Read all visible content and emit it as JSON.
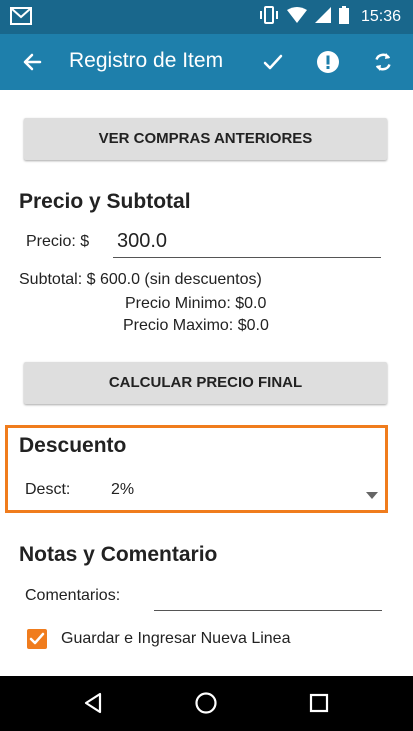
{
  "status_bar": {
    "time": "15:36"
  },
  "app_bar": {
    "title": "Registro de Item",
    "back_icon": "back-arrow-icon",
    "actions": [
      "check-icon",
      "alert-icon",
      "refresh-icon"
    ]
  },
  "buttons": {
    "ver_compras": "VER COMPRAS ANTERIORES",
    "calcular": "CALCULAR PRECIO FINAL"
  },
  "precio_section": {
    "title": "Precio y Subtotal",
    "precio_label": "Precio: $",
    "precio_value": "300.0",
    "subtotal": "Subtotal: $ 600.0 (sin descuentos)",
    "precio_minimo": "Precio Minimo: $0.0",
    "precio_maximo": "Precio Maximo: $0.0"
  },
  "descuento_section": {
    "title": "Descuento",
    "label": "Desct:",
    "selected": "2%"
  },
  "notas_section": {
    "title": "Notas y Comentario",
    "comentarios_label": "Comentarios:",
    "comentarios_value": "",
    "checkbox_label": "Guardar e Ingresar Nueva Linea",
    "checkbox_checked": true
  },
  "colors": {
    "status_bar": "#19678c",
    "app_bar": "#1e7fab",
    "accent": "#f07c1d"
  }
}
